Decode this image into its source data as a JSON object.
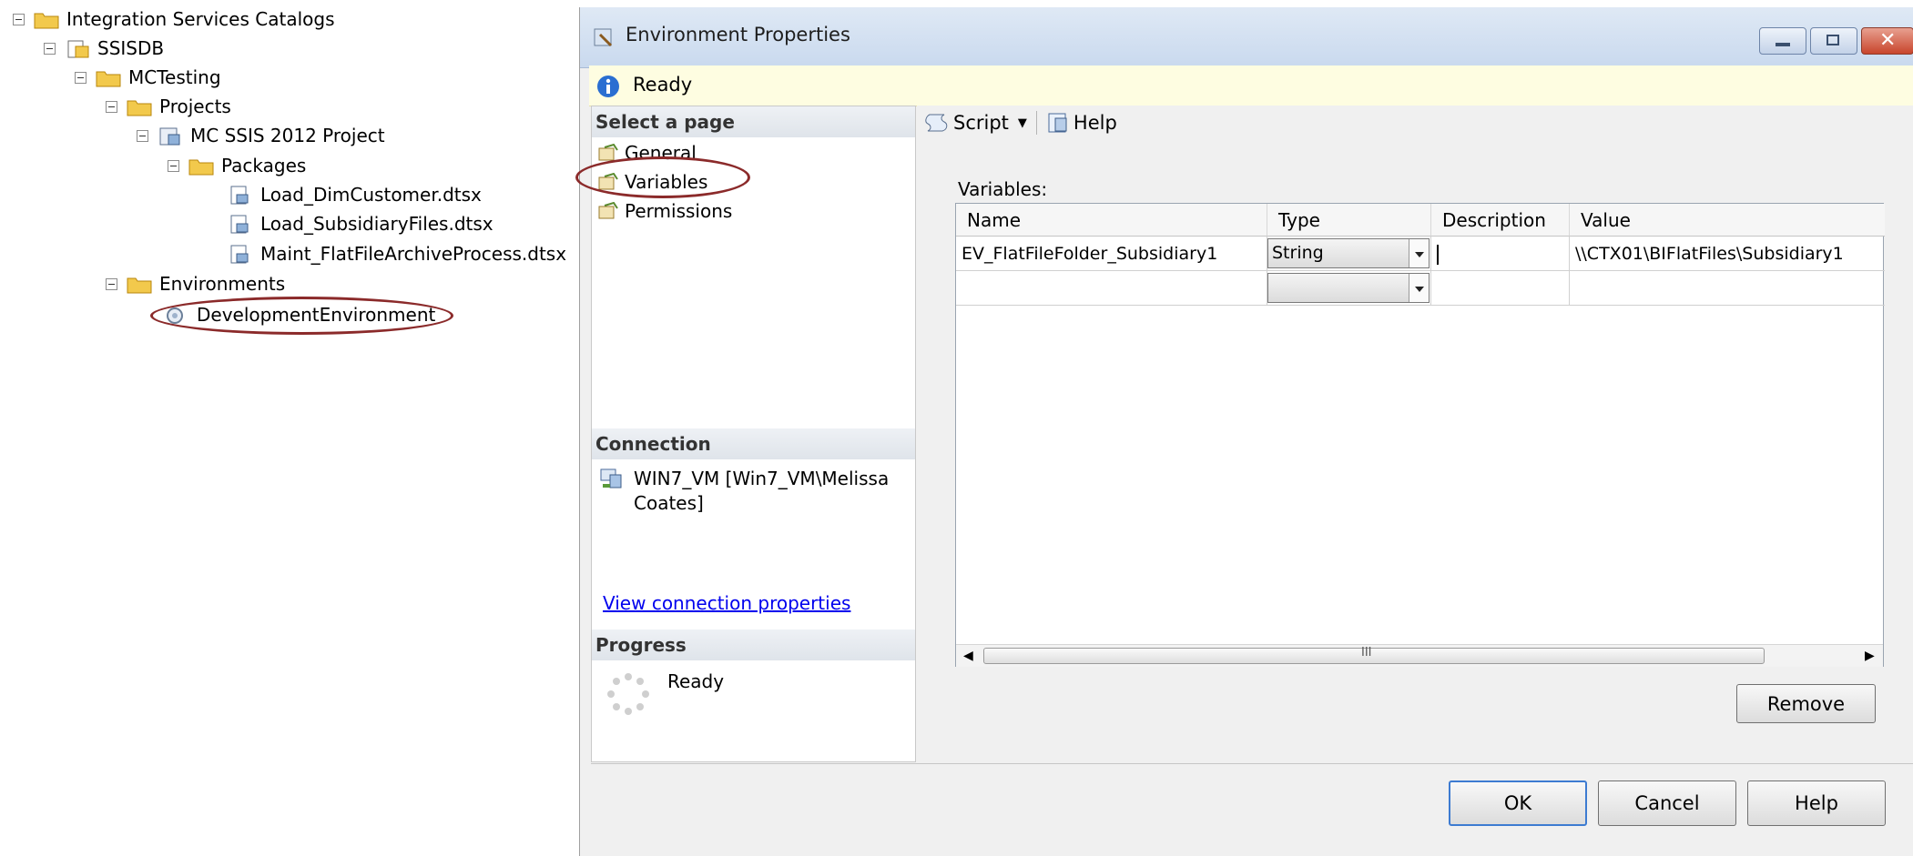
{
  "tree": {
    "root": "Integration Services Catalogs",
    "ssisdb": "SSISDB",
    "folder": "MCTesting",
    "projects": "Projects",
    "project": "MC SSIS 2012 Project",
    "packages": "Packages",
    "package_items": [
      "Load_DimCustomer.dtsx",
      "Load_SubsidiaryFiles.dtsx",
      "Maint_FlatFileArchiveProcess.dtsx"
    ],
    "environments": "Environments",
    "environment": "DevelopmentEnvironment"
  },
  "dialog": {
    "title": "Environment Properties",
    "status": "Ready",
    "select_page_header": "Select a page",
    "pages": [
      "General",
      "Variables",
      "Permissions"
    ],
    "connection_header": "Connection",
    "connection_text": "WIN7_VM [Win7_VM\\Melissa Coates]",
    "view_connection_link": "View connection properties",
    "progress_header": "Progress",
    "progress_status": "Ready",
    "toolbar": {
      "script_label": "Script",
      "help_label": "Help"
    },
    "variables_label": "Variables:",
    "columns": [
      "Name",
      "Type",
      "Description",
      "Value"
    ],
    "rows": [
      {
        "name": "EV_FlatFileFolder_Subsidiary1",
        "type": "String",
        "description": "",
        "value": "\\\\CTX01\\BIFlatFiles\\Subsidiary1"
      },
      {
        "name": "",
        "type": "",
        "description": "",
        "value": ""
      }
    ],
    "scrollbar_grip": "III",
    "remove_label": "Remove",
    "ok_label": "OK",
    "cancel_label": "Cancel",
    "help_button_label": "Help"
  },
  "colors": {
    "highlight_circle": "#8b2a2a",
    "status_bar": "#fefde1",
    "link": "#0000ee"
  }
}
